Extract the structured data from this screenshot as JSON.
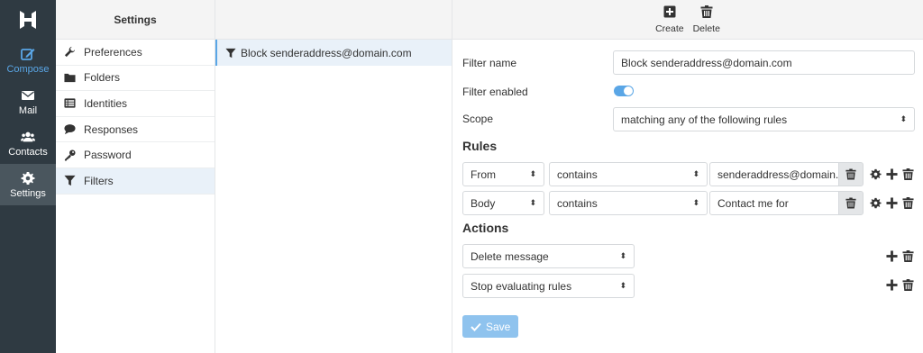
{
  "nav": {
    "items": [
      {
        "label": "Compose",
        "icon": "compose-icon"
      },
      {
        "label": "Mail",
        "icon": "envelope-icon"
      },
      {
        "label": "Contacts",
        "icon": "users-icon"
      },
      {
        "label": "Settings",
        "icon": "gear-icon"
      }
    ]
  },
  "settings": {
    "title": "Settings",
    "items": [
      {
        "label": "Preferences",
        "icon": "wrench-icon"
      },
      {
        "label": "Folders",
        "icon": "folder-icon"
      },
      {
        "label": "Identities",
        "icon": "id-card-icon"
      },
      {
        "label": "Responses",
        "icon": "speech-bubble-icon"
      },
      {
        "label": "Password",
        "icon": "key-icon"
      },
      {
        "label": "Filters",
        "icon": "filter-icon"
      }
    ]
  },
  "filter_list": {
    "items": [
      {
        "label": "Block senderaddress@domain.com",
        "icon": "filter-icon"
      }
    ]
  },
  "toolbar": {
    "create_label": "Create",
    "delete_label": "Delete"
  },
  "form": {
    "filter_name_label": "Filter name",
    "filter_name_value": "Block senderaddress@domain.com",
    "filter_enabled_label": "Filter enabled",
    "filter_enabled": true,
    "scope_label": "Scope",
    "scope_value": "matching any of the following rules",
    "rules_heading": "Rules",
    "rules": [
      {
        "header": "From",
        "operator": "contains",
        "value": "senderaddress@domain.c"
      },
      {
        "header": "Body",
        "operator": "contains",
        "value": "Contact me for"
      }
    ],
    "actions_heading": "Actions",
    "actions": [
      {
        "action": "Delete message"
      },
      {
        "action": "Stop evaluating rules"
      }
    ],
    "save_label": "Save"
  },
  "colors": {
    "accent": "#5aa6e6",
    "nav_bg": "#2f3a42",
    "save_bg": "#8fc3ee"
  }
}
